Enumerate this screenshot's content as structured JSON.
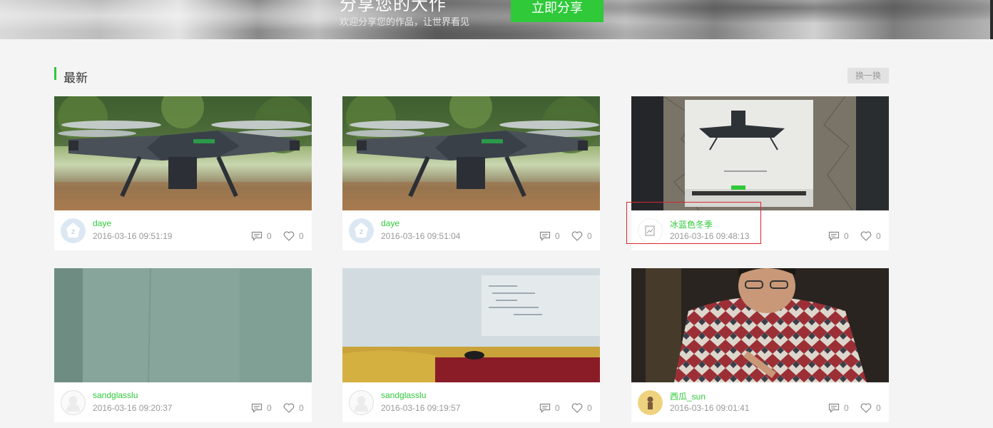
{
  "banner": {
    "title": "分享您的大作",
    "subtitle": "欢迎分享您的作品，让世界看见",
    "share_button": "立即分享"
  },
  "section": {
    "title": "最新",
    "refresh_button": "换一换"
  },
  "colors": {
    "accent": "#2fc93a",
    "highlight": "#d9262e"
  },
  "cards": [
    {
      "user": "daye",
      "time": "2016-03-16 09:51:19",
      "comments": "0",
      "likes": "0",
      "photo": "drone-photo",
      "avatar": "default-avatar"
    },
    {
      "user": "daye",
      "time": "2016-03-16 09:51:04",
      "comments": "0",
      "likes": "0",
      "photo": "drone-photo",
      "avatar": "default-avatar"
    },
    {
      "user": "冰蓝色冬季",
      "time": "2016-03-16 09:48:13",
      "comments": "0",
      "likes": "0",
      "photo": "drone-sketch-photo",
      "avatar": "broken-image-avatar"
    },
    {
      "user": "sandglasslu",
      "time": "2016-03-16 09:20:37",
      "comments": "0",
      "likes": "0",
      "photo": "wall-photo",
      "avatar": "blank-avatar"
    },
    {
      "user": "sandglasslu",
      "time": "2016-03-16 09:19:57",
      "comments": "0",
      "likes": "0",
      "photo": "room-photo",
      "avatar": "blank-avatar"
    },
    {
      "user": "西瓜_sun",
      "time": "2016-03-16 09:01:41",
      "comments": "0",
      "likes": "0",
      "photo": "portrait-photo",
      "avatar": "figure-avatar"
    }
  ]
}
